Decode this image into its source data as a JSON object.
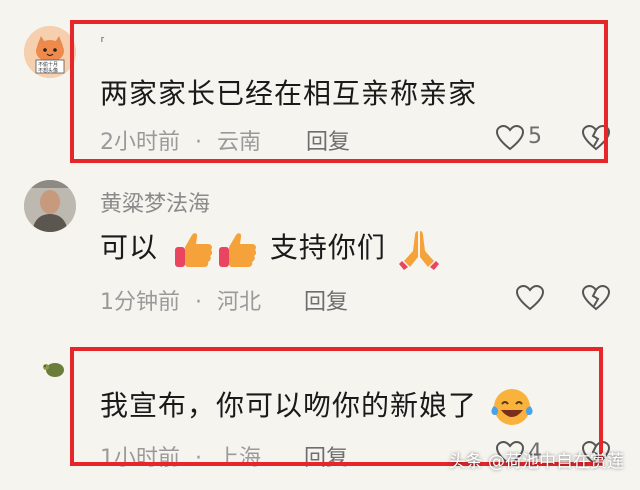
{
  "comments": [
    {
      "username": "⸢",
      "content": "两家家长已经在相互亲称亲家",
      "time": "2小时前",
      "location": "云南",
      "reply_label": "回复",
      "likes": "5",
      "avatar_text_1": "不偷十月",
      "avatar_text_2": "不想头像"
    },
    {
      "username": "黄粱梦法海",
      "content_part1": "可以",
      "content_part2": "支持你们",
      "time": "1分钟前",
      "location": "河北",
      "reply_label": "回复"
    },
    {
      "username": "",
      "content": "我宣布，你可以吻你的新娘了",
      "time": "1小时前",
      "location": "上海",
      "reply_label": "回复",
      "likes": "4"
    }
  ],
  "separator": "·",
  "watermark": "头条 @荷池中自在赏莲",
  "colors": {
    "highlight_box": "#e5262b",
    "background": "#f6f4ef"
  }
}
